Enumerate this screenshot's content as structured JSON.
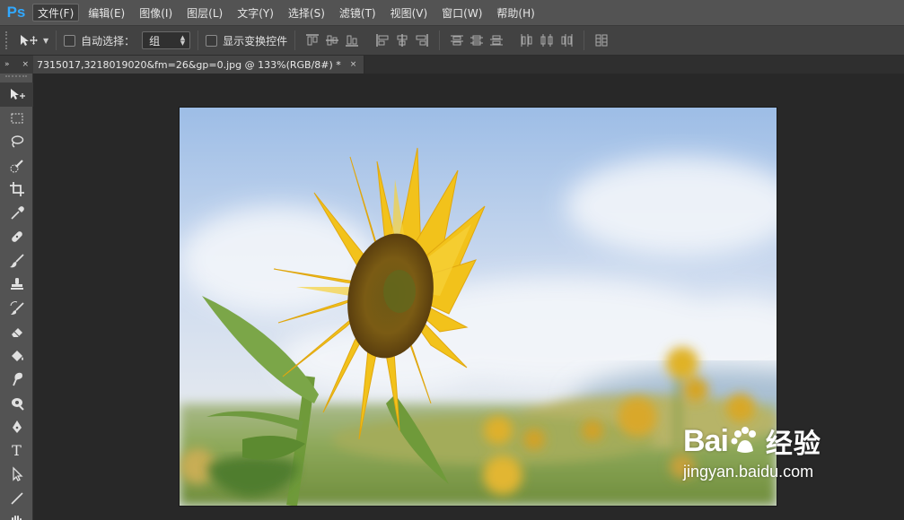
{
  "app": {
    "logo_text": "Ps"
  },
  "menu": {
    "items": [
      {
        "label": "文件(F)",
        "active": true
      },
      {
        "label": "编辑(E)"
      },
      {
        "label": "图像(I)"
      },
      {
        "label": "图层(L)"
      },
      {
        "label": "文字(Y)"
      },
      {
        "label": "选择(S)"
      },
      {
        "label": "滤镜(T)"
      },
      {
        "label": "视图(V)"
      },
      {
        "label": "窗口(W)"
      },
      {
        "label": "帮助(H)"
      }
    ]
  },
  "options": {
    "auto_select_label": "自动选择：",
    "auto_select_checked": false,
    "target_value": "组",
    "show_transform_label": "显示变换控件",
    "show_transform_checked": false
  },
  "document": {
    "tab_title": "7315017,3218019020&fm=26&gp=0.jpg @ 133%(RGB/8#) *",
    "close_glyph": "×"
  },
  "panel_mini": {
    "collapse_glyph": "»",
    "close_glyph": "×"
  },
  "tools": [
    {
      "name": "move-tool",
      "active": true
    },
    {
      "name": "marquee-tool"
    },
    {
      "name": "lasso-tool"
    },
    {
      "name": "quick-selection-tool"
    },
    {
      "name": "crop-tool"
    },
    {
      "name": "eyedropper-tool"
    },
    {
      "name": "healing-brush-tool"
    },
    {
      "name": "brush-tool"
    },
    {
      "name": "clone-stamp-tool"
    },
    {
      "name": "history-brush-tool"
    },
    {
      "name": "eraser-tool"
    },
    {
      "name": "paint-bucket-tool"
    },
    {
      "name": "smudge-tool"
    },
    {
      "name": "dodge-tool"
    },
    {
      "name": "pen-tool"
    },
    {
      "name": "type-tool",
      "glyph": "T"
    },
    {
      "name": "path-selection-tool"
    },
    {
      "name": "line-tool"
    },
    {
      "name": "hand-tool"
    }
  ],
  "watermark": {
    "logo_text_left": "Bai",
    "logo_text_right": "经验",
    "url": "jingyan.baidu.com"
  },
  "colors": {
    "ps_blue": "#31a8ff",
    "menubar": "#535353",
    "optionsbar": "#424242",
    "canvas_bg": "#282828"
  }
}
